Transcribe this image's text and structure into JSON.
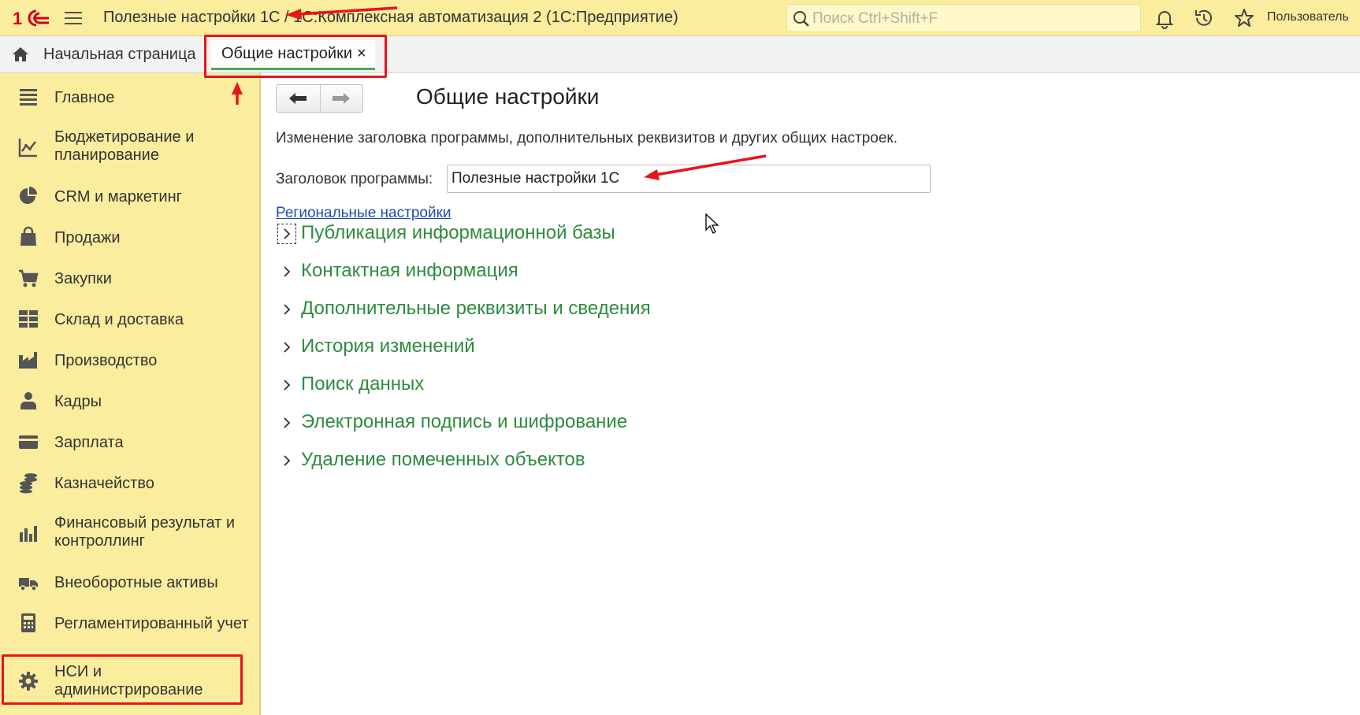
{
  "window": {
    "title": "Полезные настройки 1С / 1С:Комплексная автоматизация 2  (1С:Предприятие)",
    "logo": "1С",
    "search_placeholder": "Поиск Ctrl+Shift+F",
    "user_label": "Пользователь",
    "icons": [
      "menu-icon",
      "search-icon",
      "bell-icon",
      "history-icon",
      "star-icon"
    ]
  },
  "tabs": {
    "home_label": "Начальная страница",
    "active_label": "Общие настройки",
    "close_glyph": "×"
  },
  "sidebar": {
    "items": [
      {
        "label": "Главное",
        "icon": "list-icon"
      },
      {
        "label": "Бюджетирование и планирование",
        "icon": "chart-icon"
      },
      {
        "label": "CRM и маркетинг",
        "icon": "pie-icon"
      },
      {
        "label": "Продажи",
        "icon": "bag-icon"
      },
      {
        "label": "Закупки",
        "icon": "cart-icon"
      },
      {
        "label": "Склад и доставка",
        "icon": "warehouse-icon"
      },
      {
        "label": "Производство",
        "icon": "factory-icon"
      },
      {
        "label": "Кадры",
        "icon": "person-icon"
      },
      {
        "label": "Зарплата",
        "icon": "card-icon"
      },
      {
        "label": "Казначейство",
        "icon": "coins-icon"
      },
      {
        "label": "Финансовый результат и контроллинг",
        "icon": "bar-chart-icon"
      },
      {
        "label": "Внеоборотные активы",
        "icon": "truck-icon"
      },
      {
        "label": "Регламентированный учет",
        "icon": "calculator-icon"
      },
      {
        "label": "НСИ и администрирование",
        "icon": "gear-icon"
      }
    ]
  },
  "content": {
    "title": "Общие настройки",
    "description": "Изменение заголовка программы, дополнительных реквизитов и других общих настроек.",
    "field_label": "Заголовок программы:",
    "field_value": "Полезные настройки 1С",
    "regional_link": "Региональные настройки",
    "groups": [
      "Публикация информационной базы",
      "Контактная информация",
      "Дополнительные реквизиты и сведения",
      "История изменений",
      "Поиск данных",
      "Электронная подпись и шифрование",
      "Удаление помеченных объектов"
    ]
  },
  "colors": {
    "header_bg": "#FBED9E",
    "sidebar_bg": "#FBED9E",
    "group_text": "#2E8B3E",
    "link": "#1F4FAD",
    "annotation": "#E8141C",
    "active_tab_underline": "#4CAA56"
  }
}
